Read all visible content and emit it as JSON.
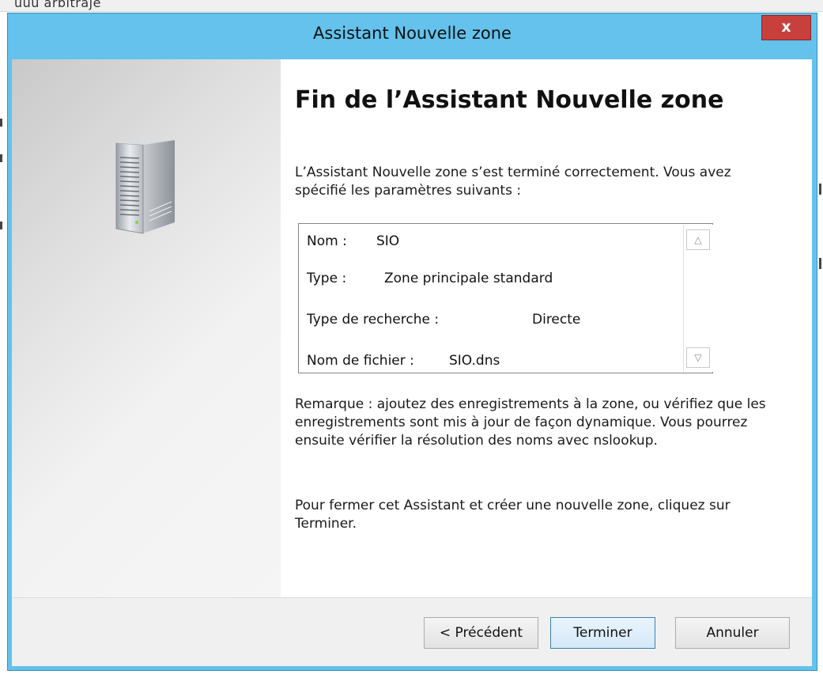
{
  "background": {
    "partial_text": "uuu  arbitraje"
  },
  "window": {
    "title": "Assistant Nouvelle zone",
    "close_label": "x",
    "accent_color": "#64c2ec",
    "close_color": "#c7403c"
  },
  "wizard": {
    "heading": "Fin de l’Assistant Nouvelle zone",
    "intro": "L’Assistant Nouvelle zone s’est terminé correctement. Vous avez spécifié les paramètres suivants :",
    "summary": [
      {
        "label": "Nom :",
        "value": "SIO"
      },
      {
        "label": "Type :",
        "value": "Zone principale standard"
      },
      {
        "label": "Type de recherche :",
        "value": "Directe"
      },
      {
        "label": "Nom de fichier :",
        "value": "SIO.dns"
      }
    ],
    "note": "Remarque : ajoutez des enregistrements à la zone, ou vérifiez que les enregistrements sont mis à jour de façon dynamique. Vous pourrez ensuite vérifier la résolution des noms avec nslookup.",
    "closing": "Pour fermer cet Assistant et créer une nouvelle zone, cliquez sur Terminer.",
    "icon": "server-tower-icon"
  },
  "buttons": {
    "previous": "< Précédent",
    "finish": "Terminer",
    "cancel": "Annuler"
  }
}
